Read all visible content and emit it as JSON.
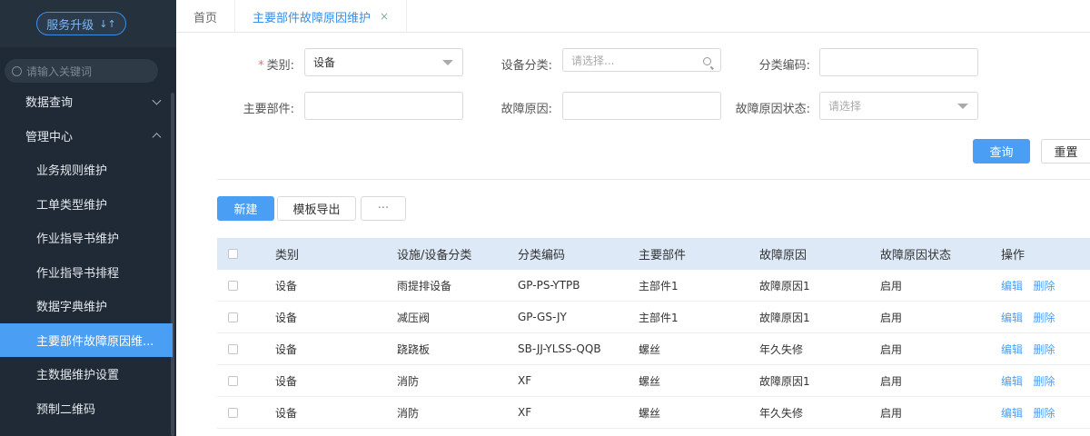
{
  "sidebar": {
    "upgrade_label": "服务升级",
    "upgrade_icon": "↓↑",
    "search_placeholder": "请输入关键词",
    "items": [
      {
        "label": "数据查询"
      },
      {
        "label": "管理中心"
      },
      {
        "label": "业务规则维护"
      },
      {
        "label": "工单类型维护"
      },
      {
        "label": "作业指导书维护"
      },
      {
        "label": "作业指导书排程"
      },
      {
        "label": "数据字典维护"
      },
      {
        "label": "主要部件故障原因维..."
      },
      {
        "label": "主数据维护设置"
      },
      {
        "label": "预制二维码"
      }
    ]
  },
  "tabs": {
    "home": "首页",
    "current": "主要部件故障原因维护",
    "close": "×"
  },
  "form": {
    "category_label": "类别:",
    "category_required": "*",
    "category_value": "设备",
    "device_class_label": "设备分类:",
    "device_class_placeholder": "请选择...",
    "class_code_label": "分类编码:",
    "main_part_label": "主要部件:",
    "fault_reason_label": "故障原因:",
    "fault_status_label": "故障原因状态:",
    "fault_status_placeholder": "请选择"
  },
  "actions": {
    "query": "查询",
    "reset": "重置",
    "new": "新建",
    "export": "模板导出",
    "more": "···"
  },
  "table": {
    "headers": [
      "类别",
      "设施/设备分类",
      "分类编码",
      "主要部件",
      "故障原因",
      "故障原因状态",
      "操作"
    ],
    "edit_label": "编辑",
    "delete_label": "删除",
    "rows": [
      {
        "type": "设备",
        "class": "雨提排设备",
        "code": "GP-PS-YTPB",
        "part": "主部件1",
        "reason": "故障原因1",
        "status": "启用"
      },
      {
        "type": "设备",
        "class": "减压阀",
        "code": "GP-GS-JY",
        "part": "主部件1",
        "reason": "故障原因1",
        "status": "启用"
      },
      {
        "type": "设备",
        "class": "跷跷板",
        "code": "SB-JJ-YLSS-QQB",
        "part": "螺丝",
        "reason": "年久失修",
        "status": "启用"
      },
      {
        "type": "设备",
        "class": "消防",
        "code": "XF",
        "part": "螺丝",
        "reason": "故障原因1",
        "status": "启用"
      },
      {
        "type": "设备",
        "class": "消防",
        "code": "XF",
        "part": "螺丝",
        "reason": "年久失修",
        "status": "启用"
      }
    ]
  }
}
